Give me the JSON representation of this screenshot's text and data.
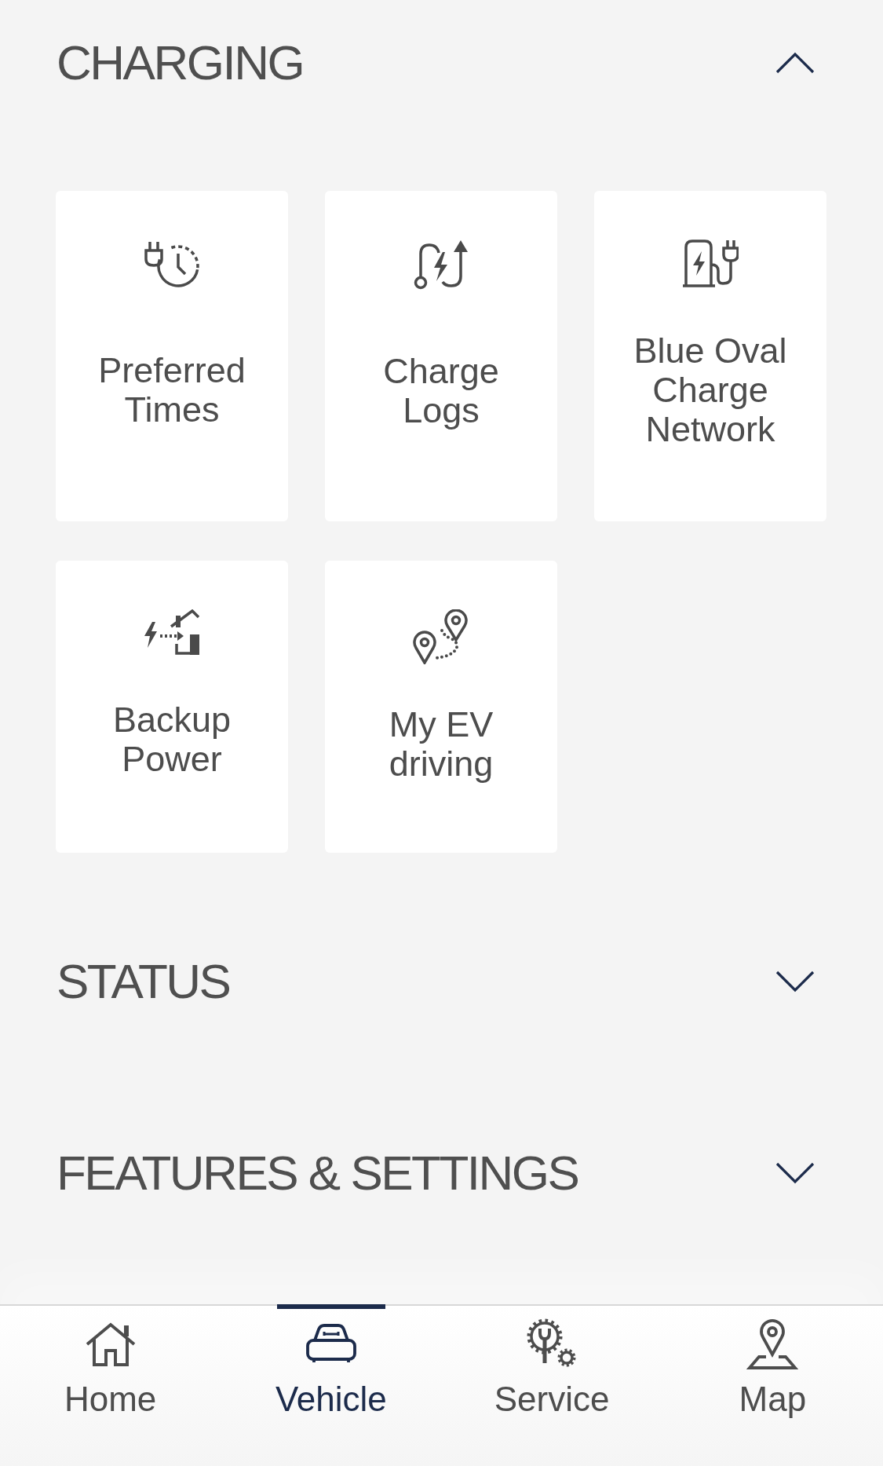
{
  "sections": [
    {
      "title": "CHARGING",
      "expanded": true,
      "tiles": [
        {
          "label": "Preferred Times",
          "kind": "schedule"
        },
        {
          "label": "Charge Logs",
          "kind": "logs"
        },
        {
          "label": "Blue Oval Charge Network",
          "kind": "network"
        },
        {
          "label": "Backup Power",
          "kind": "backup"
        },
        {
          "label": "My EV driving",
          "kind": "trips"
        }
      ]
    },
    {
      "title": "STATUS",
      "expanded": false
    },
    {
      "title": "FEATURES & SETTINGS",
      "expanded": false
    }
  ],
  "nav": [
    {
      "label": "Home",
      "kind": "home",
      "selected": false
    },
    {
      "label": "Vehicle",
      "kind": "vehicle",
      "selected": true
    },
    {
      "label": "Service",
      "kind": "service",
      "selected": false
    },
    {
      "label": "Map",
      "kind": "map",
      "selected": false
    }
  ]
}
